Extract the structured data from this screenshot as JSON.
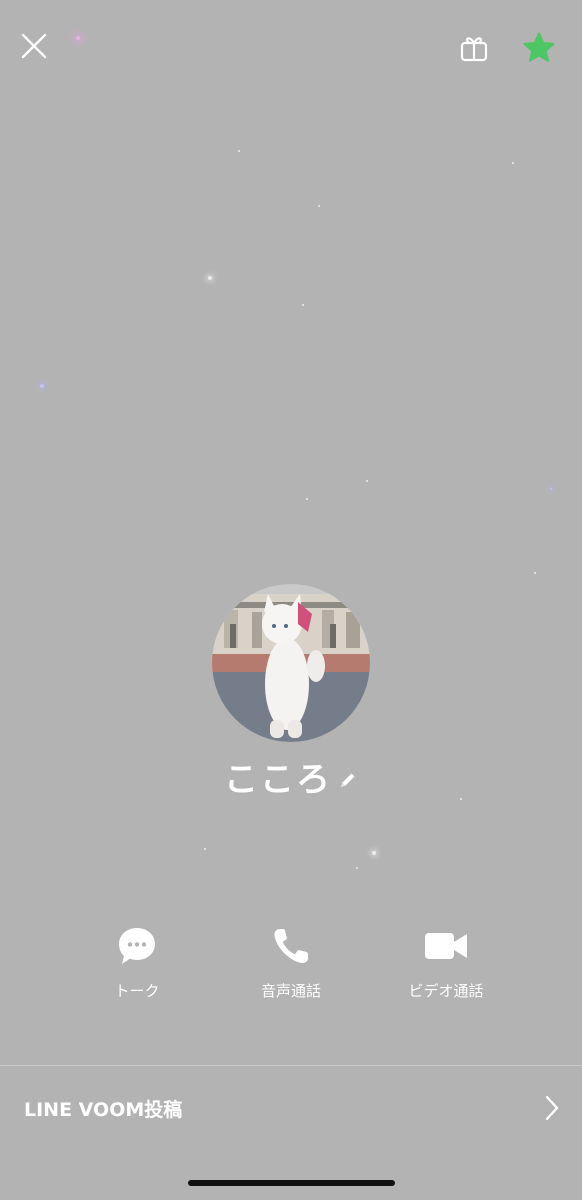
{
  "profile": {
    "name": "こころ"
  },
  "actions": [
    {
      "label": "トーク",
      "icon": "chat-bubble-icon"
    },
    {
      "label": "音声通話",
      "icon": "phone-icon"
    },
    {
      "label": "ビデオ通話",
      "icon": "video-camera-icon"
    }
  ],
  "footer": {
    "voom_label": "LINE VOOM投稿"
  },
  "header": {
    "close_icon": "close-icon",
    "gift_icon": "gift-icon",
    "favorite_icon": "star-icon"
  },
  "colors": {
    "background": "#b3b3b3",
    "favorite_star": "#4cc764",
    "text": "#ffffff"
  }
}
